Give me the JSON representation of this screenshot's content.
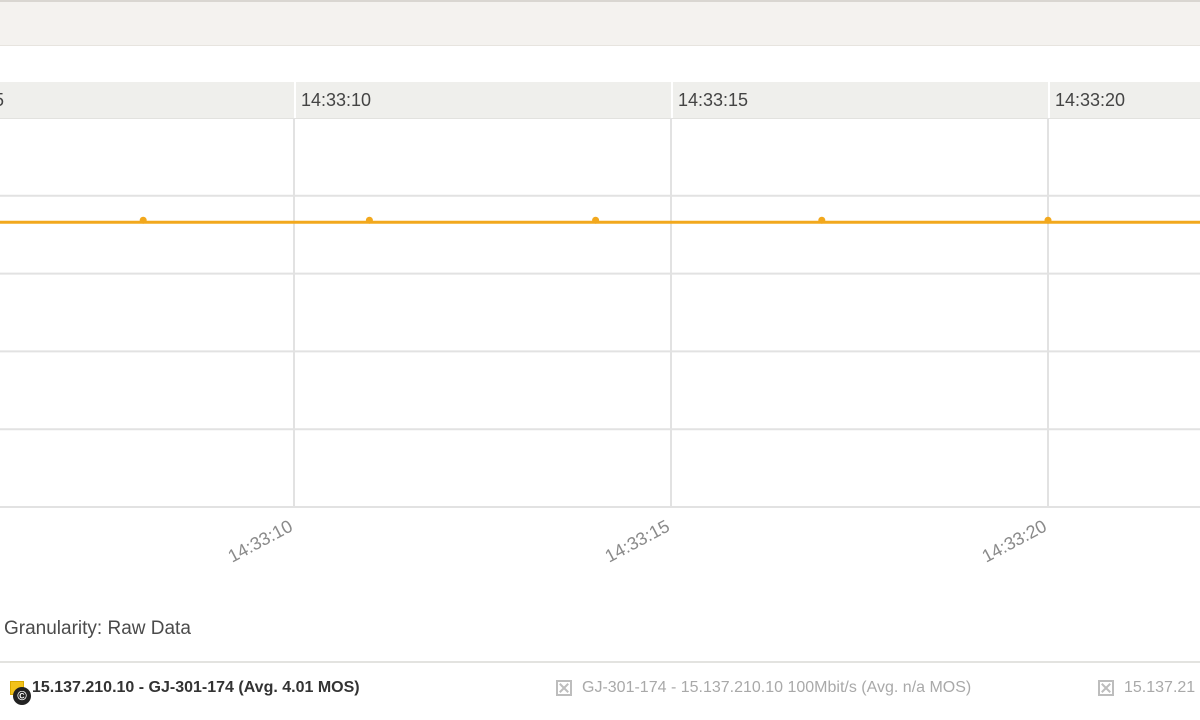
{
  "header_ticks": [
    "5",
    "14:33:10",
    "14:33:15",
    "14:33:20"
  ],
  "granularity_label": "Granularity: Raw Data",
  "legend": [
    {
      "label": "15.137.210.10 - GJ-301-174 (Avg. 4.01 MOS)",
      "active": true
    },
    {
      "label": "GJ-301-174 - 15.137.210.10 100Mbit/s (Avg. n/a MOS)",
      "active": false
    },
    {
      "label": "15.137.21",
      "active": false
    }
  ],
  "copyright_symbol": "©",
  "colors": {
    "series": "#f2a81d",
    "grid": "#e2e2e2",
    "header_bg": "#efefec"
  },
  "chart_data": {
    "type": "line",
    "x_tick_labels": [
      "14:33:10",
      "14:33:15",
      "14:33:20"
    ],
    "x_ticks_seconds": [
      10,
      15,
      20
    ],
    "xlim_seconds": [
      6.1,
      26.0
    ],
    "y_gridlines": 5,
    "series": [
      {
        "name": "15.137.210.10 - GJ-301-174 (Avg. 4.01 MOS)",
        "color": "#f2a81d",
        "x_seconds": [
          6.1,
          8.0,
          11.0,
          14.0,
          17.0,
          20.0,
          26.0
        ],
        "y": [
          4.01,
          4.01,
          4.01,
          4.01,
          4.01,
          4.01,
          4.01
        ],
        "markers_at_seconds": [
          8.0,
          11.0,
          14.0,
          17.0,
          20.0
        ]
      }
    ],
    "ylim": [
      3.6,
      4.16
    ],
    "grid": true
  }
}
